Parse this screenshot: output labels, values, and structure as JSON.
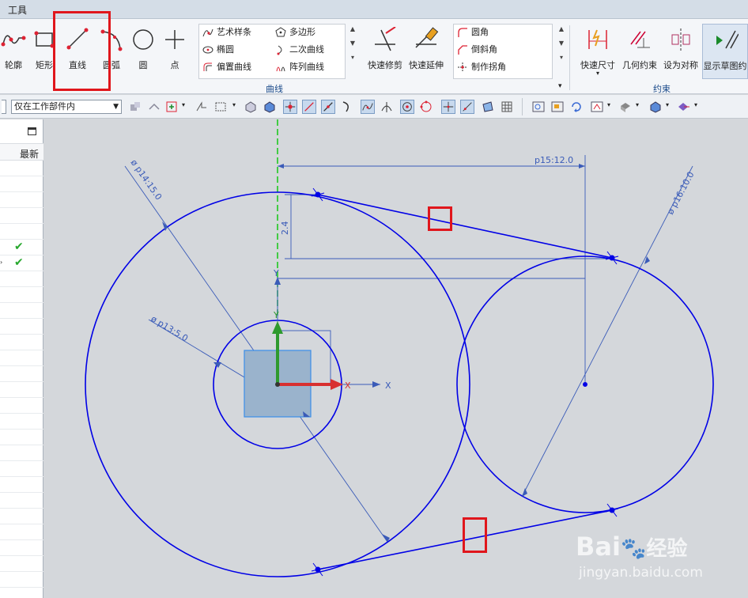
{
  "menubar": {
    "menu_tools": "工具"
  },
  "ribbon": {
    "buttons": {
      "profile": "轮廓",
      "rectangle": "矩形",
      "line": "直线",
      "arc": "圆弧",
      "circle": "圆",
      "point": "点"
    },
    "curve_list_left": [
      "艺术样条",
      "椭圆",
      "偏置曲线"
    ],
    "curve_list_right": [
      "多边形",
      "二次曲线",
      "阵列曲线"
    ],
    "quick_trim": "快速修剪",
    "quick_extend": "快速延伸",
    "corner_list": [
      "圆角",
      "倒斜角",
      "制作拐角"
    ],
    "group_curve": "曲线",
    "constraint_buttons": {
      "rapid_dimension": "快速尺寸",
      "geometric_constraint": "几何约束",
      "make_symmetric": "设为对称",
      "show_sketch_constraints": "显示草图约"
    },
    "group_constraint": "约束"
  },
  "toolbar2": {
    "selection_scope": "仅在工作部件内"
  },
  "navigator": {
    "column_latest": "最新",
    "check_rows": 2
  },
  "sketch": {
    "dim_p14": "ø p14:15.0",
    "dim_p13": "ø p13:5.0",
    "dim_p15": "p15:12.0",
    "dim_p16": "ø p16:10.0",
    "dim_vertical": "2.4",
    "axis_x": "X",
    "axis_y": "Y",
    "colors": {
      "curve": "#0000e6",
      "dimension": "#3a5bb8",
      "highlight": "#e0161c",
      "axis_green": "#1ec81e"
    }
  },
  "watermark": {
    "brand": "Bai",
    "brand_cn": "经验",
    "url": "jingyan.baidu.com"
  }
}
